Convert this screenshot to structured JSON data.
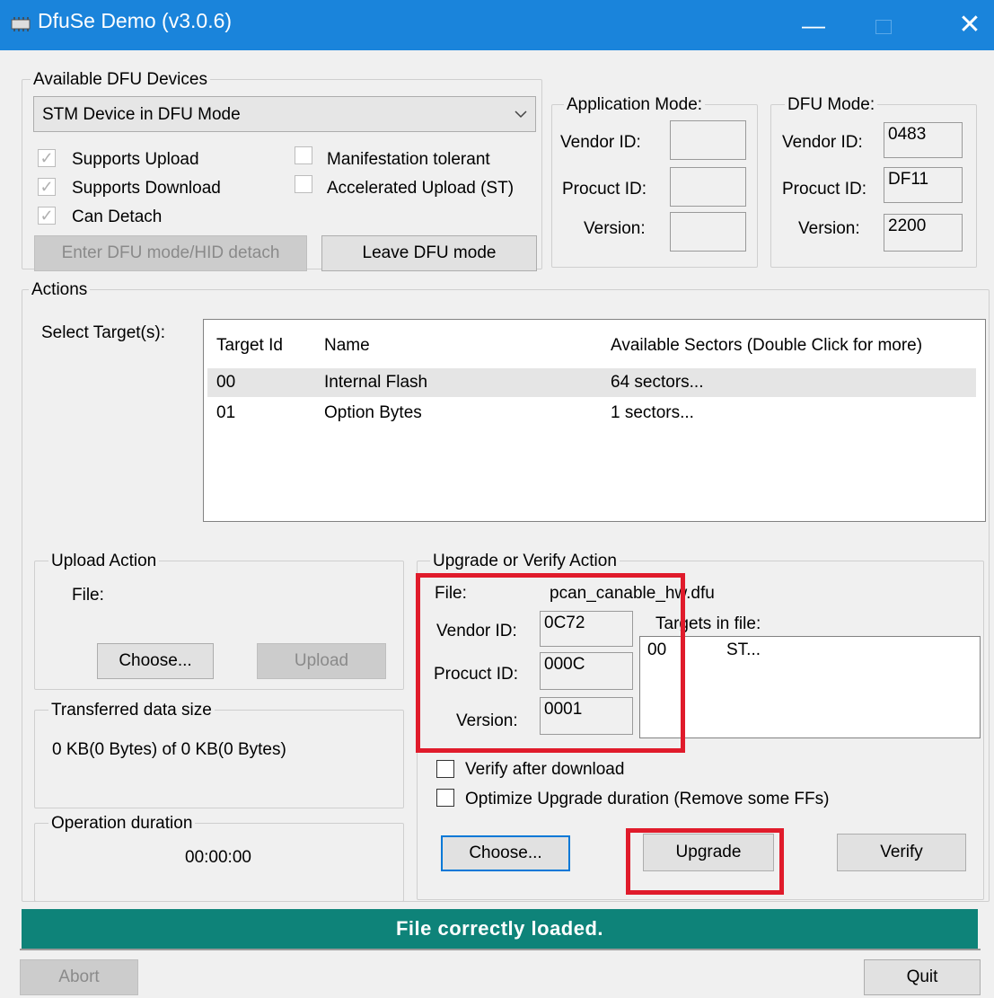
{
  "window": {
    "title": "DfuSe Demo (v3.0.6)",
    "minimize": "—",
    "close": "✕"
  },
  "devices": {
    "group_title": "Available DFU Devices",
    "selected": "STM Device in DFU Mode",
    "supports_upload": "Supports Upload",
    "supports_download": "Supports Download",
    "can_detach": "Can Detach",
    "manifestation_tolerant": "Manifestation tolerant",
    "accelerated_upload": "Accelerated Upload (ST)",
    "enter_dfu_button": "Enter DFU mode/HID detach",
    "leave_dfu_button": "Leave DFU mode"
  },
  "app_mode": {
    "title": "Application Mode:",
    "vendor_label": "Vendor ID:",
    "product_label": "Procuct ID:",
    "version_label": "Version:",
    "vendor": "",
    "product": "",
    "version": ""
  },
  "dfu_mode": {
    "title": "DFU Mode:",
    "vendor_label": "Vendor ID:",
    "product_label": "Procuct ID:",
    "version_label": "Version:",
    "vendor": "0483",
    "product": "DF11",
    "version": "2200"
  },
  "actions": {
    "title": "Actions",
    "select_targets": "Select Target(s):",
    "columns": [
      "Target Id",
      "Name",
      "Available Sectors (Double Click for more)"
    ],
    "rows": [
      [
        "00",
        "Internal Flash",
        "64 sectors..."
      ],
      [
        "01",
        "Option Bytes",
        "1 sectors..."
      ]
    ]
  },
  "upload": {
    "title": "Upload Action",
    "file_label": "File:",
    "choose": "Choose...",
    "upload": "Upload"
  },
  "transferred": {
    "title": "Transferred data size",
    "value": "0 KB(0 Bytes) of 0 KB(0 Bytes)"
  },
  "duration": {
    "title": "Operation duration",
    "value": "00:00:00"
  },
  "upgrade": {
    "title": "Upgrade or Verify Action",
    "file_label": "File:",
    "file": "pcan_canable_hw.dfu",
    "vendor_label": "Vendor ID:",
    "product_label": "Procuct ID:",
    "version_label": "Version:",
    "vendor": "0C72",
    "product": "000C",
    "version": "0001",
    "targets_label": "Targets in file:",
    "targets": [
      [
        "00",
        "ST..."
      ]
    ],
    "verify_after": "Verify after download",
    "optimize": "Optimize Upgrade duration (Remove some FFs)",
    "choose": "Choose...",
    "upgrade": "Upgrade",
    "verify": "Verify"
  },
  "status": "File correctly loaded.",
  "bottom": {
    "abort": "Abort",
    "quit": "Quit"
  },
  "colors": {
    "titlebar": "#1a84db",
    "status": "#0e8379",
    "highlight": "#e01b2b"
  }
}
